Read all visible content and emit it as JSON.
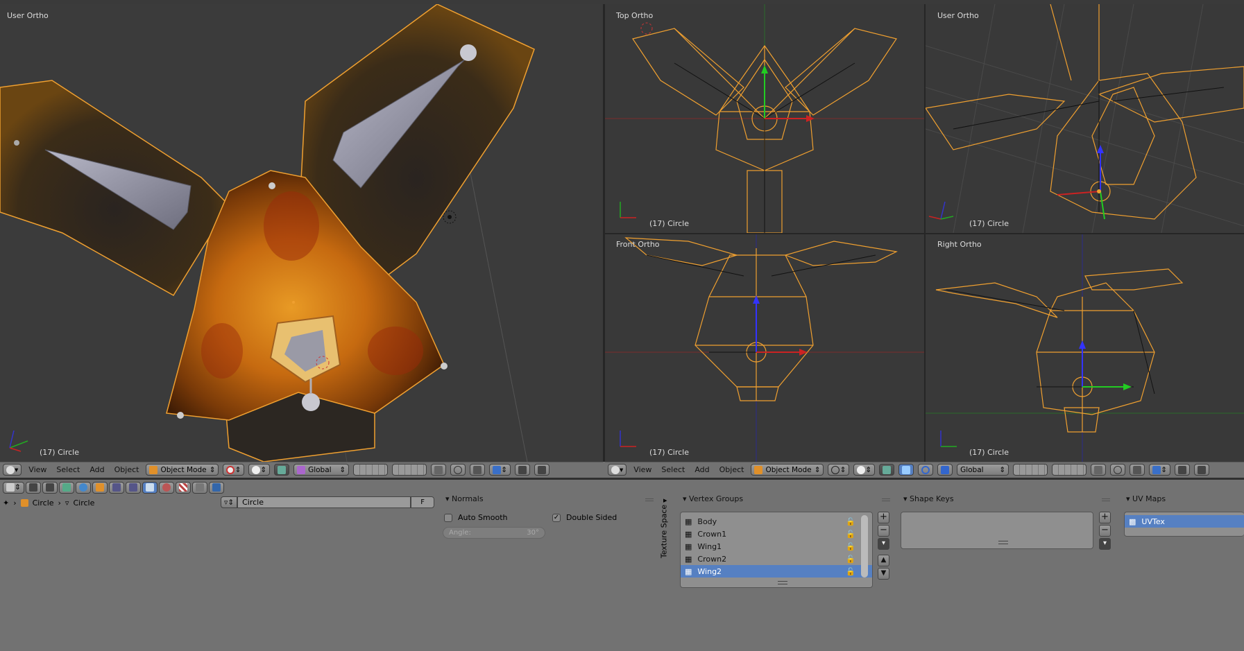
{
  "viewports": {
    "main": {
      "label": "User Ortho",
      "object": "(17) Circle"
    },
    "top": {
      "label": "Top Ortho",
      "object": "(17) Circle"
    },
    "user2": {
      "label": "User Ortho",
      "object": "(17) Circle"
    },
    "front": {
      "label": "Front Ortho",
      "object": "(17) Circle"
    },
    "right": {
      "label": "Right Ortho",
      "object": "(17) Circle"
    }
  },
  "header_left": {
    "menus": [
      "View",
      "Select",
      "Add",
      "Object"
    ],
    "mode": "Object Mode",
    "orientation": "Global"
  },
  "header_right": {
    "menus": [
      "View",
      "Select",
      "Add",
      "Object"
    ],
    "mode": "Object Mode",
    "orientation": "Global"
  },
  "properties": {
    "breadcrumb": {
      "object": "Circle",
      "mesh": "Circle"
    },
    "mesh_name": "Circle",
    "fake_user": "F",
    "normals": {
      "title": "Normals",
      "auto_smooth": "Auto Smooth",
      "double_sided": "Double Sided",
      "angle_label": "Angle:",
      "angle_value": "30°"
    },
    "texture_space": "Texture Space",
    "vertex_groups": {
      "title": "Vertex Groups",
      "items": [
        "Body",
        "Crown1",
        "Wing1",
        "Crown2",
        "Wing2"
      ],
      "selected": "Wing2"
    },
    "shape_keys": {
      "title": "Shape Keys"
    },
    "uv_maps": {
      "title": "UV Maps",
      "items": [
        "UVTex"
      ]
    }
  },
  "colors": {
    "viewport_bg": "#393939",
    "panel_bg": "#727272",
    "selection_blue": "#5680c2",
    "wire_orange": "#f0a030"
  }
}
